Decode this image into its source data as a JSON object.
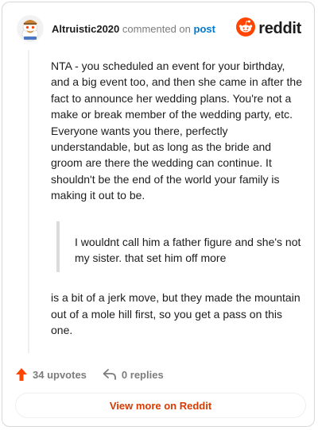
{
  "header": {
    "author": "Altruistic2020",
    "commented_on": "commented on",
    "post_link": "post",
    "brand_name": "reddit"
  },
  "comment": {
    "paragraph1": "NTA - you scheduled an event for your birthday, and a big event too, and then she came in after the fact to announce her wedding plans. You're not a make or break member of the wedding party, etc. Everyone wants you there, perfectly understandable, but as long as the bride and groom are there the wedding can continue. It shouldn't be the end of the world your family is making it out to be.",
    "quote": "I wouldnt call him a father figure and she's not my sister. that set him off more",
    "paragraph2": "is a bit of a jerk move, but they made the mountain out of a mole hill first, so you get a pass on this one."
  },
  "footer": {
    "upvotes": "34 upvotes",
    "replies": "0 replies",
    "view_more": "View more on Reddit"
  },
  "colors": {
    "reddit_orange": "#ff4500",
    "link_blue": "#0079d3",
    "view_more_text": "#d93a00",
    "muted_text": "#7c7c7c"
  },
  "icons": [
    "avatar-snoo",
    "reddit-logo-icon",
    "upvote-arrow-icon",
    "reply-arrow-icon"
  ]
}
